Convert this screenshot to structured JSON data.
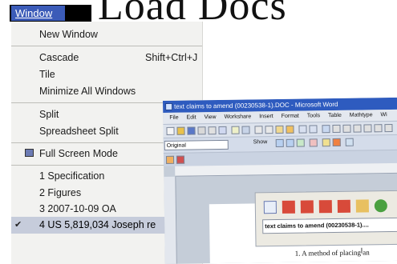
{
  "background_title": "Load Docs",
  "menubar": {
    "window_label": "Window"
  },
  "window_menu": {
    "items": [
      {
        "label": "New Window"
      },
      {
        "label": "Cascade",
        "shortcut": "Shift+Ctrl+J"
      },
      {
        "label": "Tile"
      },
      {
        "label": "Minimize All Windows"
      },
      {
        "label": "Split"
      },
      {
        "label": "Spreadsheet Split"
      },
      {
        "label": "Full Screen Mode"
      },
      {
        "label": "1 Specification"
      },
      {
        "label": "2 Figures"
      },
      {
        "label": "3 2007-10-09 OA"
      },
      {
        "label": "4 US 5,819,034 Joseph re"
      }
    ],
    "checked_item": "4 US 5,819,034 Joseph re"
  },
  "word_window": {
    "title": "text claims to amend (00230538-1).DOC - Microsoft Word",
    "menu": [
      "File",
      "Edit",
      "View",
      "Workshare",
      "Insert",
      "Format",
      "Tools",
      "Table",
      "Mathtype",
      "Wi"
    ],
    "view_select": "Original",
    "show_label": "Show",
    "panel_input": "text claims to amend (00230538-1)....",
    "doc_text": "1. A method of placing an"
  },
  "colors": {
    "menu_highlight": "#3b5bb8",
    "word_titlebar": "#2e5bbf",
    "menu_bg": "#f2f2f0"
  }
}
